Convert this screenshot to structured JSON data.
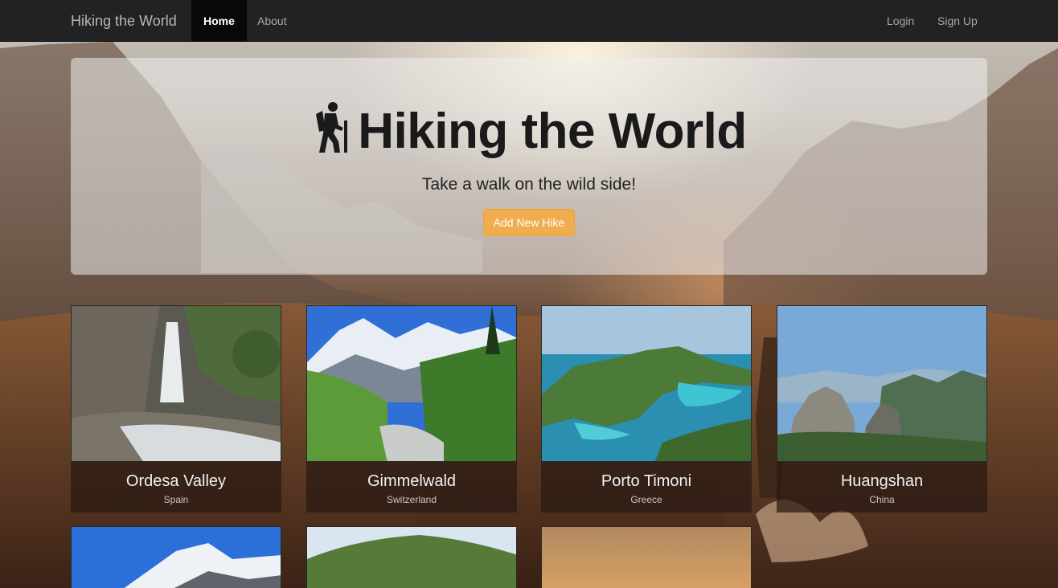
{
  "navbar": {
    "brand": "Hiking the World",
    "links": [
      {
        "label": "Home",
        "active": true
      },
      {
        "label": "About",
        "active": false
      }
    ],
    "right_links": [
      {
        "label": "Login"
      },
      {
        "label": "Sign Up"
      }
    ]
  },
  "hero": {
    "title": "Hiking the World",
    "icon": "hiker-icon",
    "subtitle": "Take a walk on the wild side!",
    "button_label": "Add New Hike",
    "button_color": "#f0ad4e"
  },
  "hikes": [
    {
      "name": "Ordesa Valley",
      "country": "Spain"
    },
    {
      "name": "Gimmelwald",
      "country": "Switzerland"
    },
    {
      "name": "Porto Timoni",
      "country": "Greece"
    },
    {
      "name": "Huangshan",
      "country": "China"
    }
  ]
}
